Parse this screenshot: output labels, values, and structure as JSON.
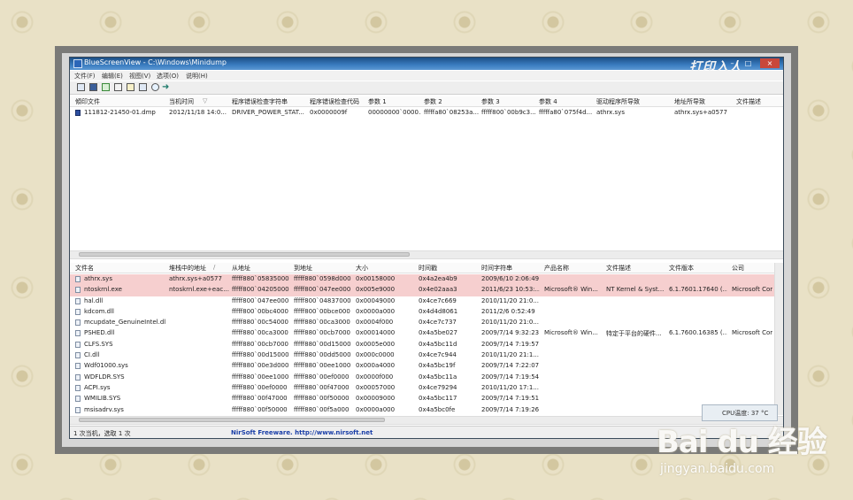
{
  "window": {
    "title": "BlueScreenView - C:\\Windows\\Minidump",
    "watermark_text": "打印入人",
    "controls": [
      "–",
      "□",
      "×"
    ]
  },
  "menu": [
    "文件(F)",
    "编辑(E)",
    "视图(V)",
    "选项(O)",
    "说明(H)"
  ],
  "toolbar_icons": [
    "open-icon",
    "save-icon",
    "html-report-icon",
    "copy-icon",
    "properties-icon",
    "refresh-icon",
    "find-icon",
    "exit-icon"
  ],
  "upper_table": {
    "columns": [
      "傾印文件",
      "当机时间",
      "程序错误检查字符串",
      "程序错误检查代码",
      "参数 1",
      "参数 2",
      "参数 3",
      "参数 4",
      "驱动程序所导致",
      "地址所导致",
      "文件描述"
    ],
    "sort_indicator": "▽",
    "rows": [
      [
        "111812-21450-01.dmp",
        "2012/11/18 14:0...",
        "DRIVER_POWER_STAT...",
        "0x0000009f",
        "00000000`0000...",
        "fffffa80`08253a...",
        "fffff800`00b9c3...",
        "fffffa80`075f4d...",
        "athrx.sys",
        "athrx.sys+a0577",
        ""
      ]
    ]
  },
  "lower_table": {
    "columns": [
      "文件名",
      "堆栈中的地址",
      "从地址",
      "到地址",
      "大小",
      "时间戳",
      "时间字符串",
      "产品名称",
      "文件描述",
      "文件版本",
      "公司"
    ],
    "sort_indicator": "/",
    "rows": [
      [
        "athrx.sys",
        "athrx.sys+a0577",
        "fffff880`05835000",
        "fffff880`0598d000",
        "0x00158000",
        "0x4a2ea4b9",
        "2009/6/10 2:06:49",
        "",
        "",
        "",
        ""
      ],
      [
        "ntoskrnl.exe",
        "ntoskrnl.exe+eac...",
        "fffff800`04205000",
        "fffff800`047ee000",
        "0x005e9000",
        "0x4e02aaa3",
        "2011/6/23 10:53:...",
        "Microsoft® Win...",
        "NT Kernel & Syst...",
        "6.1.7601.17640 (...",
        "Microsoft Cor"
      ],
      [
        "hal.dll",
        "",
        "fffff800`047ee000",
        "fffff800`04837000",
        "0x00049000",
        "0x4ce7c669",
        "2010/11/20 21:0...",
        "",
        "",
        "",
        ""
      ],
      [
        "kdcom.dll",
        "",
        "fffff800`00bc4000",
        "fffff800`00bce000",
        "0x0000a000",
        "0x4d4d8061",
        "2011/2/6 0:52:49",
        "",
        "",
        "",
        ""
      ],
      [
        "mcupdate_GenuineIntel.dll",
        "",
        "fffff880`00c54000",
        "fffff880`00ca3000",
        "0x0004f000",
        "0x4ce7c737",
        "2010/11/20 21:0...",
        "",
        "",
        "",
        ""
      ],
      [
        "PSHED.dll",
        "",
        "fffff880`00ca3000",
        "fffff880`00cb7000",
        "0x00014000",
        "0x4a5be027",
        "2009/7/14 9:32:23",
        "Microsoft® Win...",
        "特定于平台的硬件...",
        "6.1.7600.16385 (...",
        "Microsoft Cor"
      ],
      [
        "CLFS.SYS",
        "",
        "fffff880`00cb7000",
        "fffff880`00d15000",
        "0x0005e000",
        "0x4a5bc11d",
        "2009/7/14 7:19:57",
        "",
        "",
        "",
        ""
      ],
      [
        "CI.dll",
        "",
        "fffff880`00d15000",
        "fffff880`00dd5000",
        "0x000c0000",
        "0x4ce7c944",
        "2010/11/20 21:1...",
        "",
        "",
        "",
        ""
      ],
      [
        "Wdf01000.sys",
        "",
        "fffff880`00e3d000",
        "fffff880`00ee1000",
        "0x000a4000",
        "0x4a5bc19f",
        "2009/7/14 7:22:07",
        "",
        "",
        "",
        ""
      ],
      [
        "WDFLDR.SYS",
        "",
        "fffff880`00ee1000",
        "fffff880`00ef0000",
        "0x0000f000",
        "0x4a5bc11a",
        "2009/7/14 7:19:54",
        "",
        "",
        "",
        ""
      ],
      [
        "ACPI.sys",
        "",
        "fffff880`00ef0000",
        "fffff880`00f47000",
        "0x00057000",
        "0x4ce79294",
        "2010/11/20 17:1...",
        "",
        "",
        "",
        ""
      ],
      [
        "WMILIB.SYS",
        "",
        "fffff880`00f47000",
        "fffff880`00f50000",
        "0x00009000",
        "0x4a5bc117",
        "2009/7/14 7:19:51",
        "",
        "",
        "",
        ""
      ],
      [
        "msisadrv.sys",
        "",
        "fffff880`00f50000",
        "fffff880`00f5a000",
        "0x0000a000",
        "0x4a5bc0fe",
        "2009/7/14 7:19:26",
        "",
        "",
        "",
        ""
      ]
    ],
    "highlighted_rows": [
      0,
      1
    ]
  },
  "status": {
    "count_text": "1 次当机，选取 1 次",
    "link_text": "NirSoft Freeware.  http://www.nirsoft.net"
  },
  "popup_text": "CPU温度: 37 °C",
  "watermark": {
    "logo": "Bai du 经验",
    "url": "jingyan.baidu.com"
  },
  "colors": {
    "titlebar": "#2a64a8",
    "highlight_row": "#f6cfcf",
    "link": "#1a3fa8"
  }
}
